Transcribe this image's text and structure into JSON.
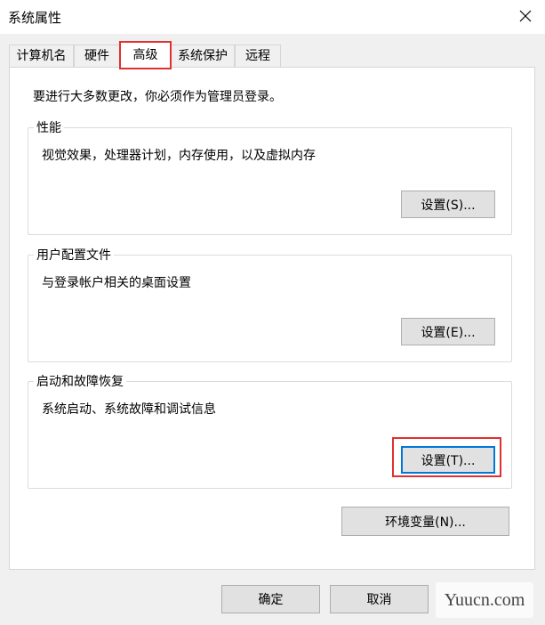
{
  "window": {
    "title": "系统属性"
  },
  "tabs": [
    {
      "label": "计算机名"
    },
    {
      "label": "硬件"
    },
    {
      "label": "高级"
    },
    {
      "label": "系统保护"
    },
    {
      "label": "远程"
    }
  ],
  "advanced": {
    "intro": "要进行大多数更改，你必须作为管理员登录。",
    "performance": {
      "title": "性能",
      "description": "视觉效果，处理器计划，内存使用，以及虚拟内存",
      "button": "设置(S)..."
    },
    "user_profiles": {
      "title": "用户配置文件",
      "description": "与登录帐户相关的桌面设置",
      "button": "设置(E)..."
    },
    "startup_recovery": {
      "title": "启动和故障恢复",
      "description": "系统启动、系统故障和调试信息",
      "button": "设置(T)..."
    },
    "env_button": "环境变量(N)..."
  },
  "footer": {
    "ok": "确定",
    "cancel": "取消"
  },
  "watermark": "Yuucn.com",
  "colors": {
    "highlight": "#e0302f",
    "focus": "#0078d7"
  }
}
